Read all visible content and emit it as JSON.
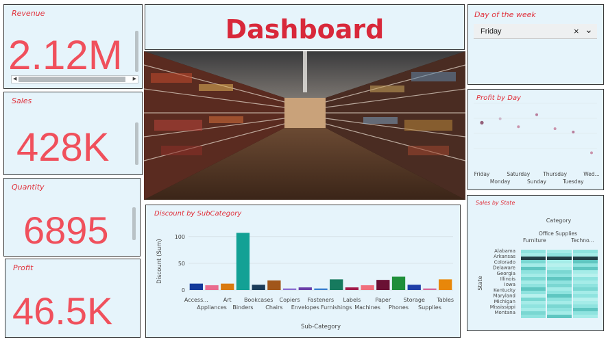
{
  "kpis": {
    "revenue": {
      "title": "Revenue",
      "value": "2.12M"
    },
    "sales": {
      "title": "Sales",
      "value": "428K"
    },
    "quantity": {
      "title": "Quantity",
      "value": "6895"
    },
    "profit": {
      "title": "Profit",
      "value": "46.5K"
    }
  },
  "header": {
    "title": "Dashboard"
  },
  "image": {
    "alt": "Supermarket aisle"
  },
  "filter": {
    "title": "Day of the week",
    "selected": "Friday",
    "clear_glyph": "×",
    "chevron_glyph": "⌄"
  },
  "colors": {
    "accent": "#e0303b",
    "kpi_value": "#f0505c",
    "panel_bg": "#e6f4fb"
  },
  "chart_data": [
    {
      "type": "bar",
      "title": "Discount  by SubCategory",
      "xlabel": "Sub-Category",
      "ylabel": "Discount (Sum)",
      "ylim": [
        0,
        110
      ],
      "yticks": [
        0,
        50,
        100
      ],
      "grid": true,
      "categories": [
        "Access...",
        "Appliances",
        "Art",
        "Binders",
        "Bookcases",
        "Chairs",
        "Copiers",
        "Envelopes",
        "Fasteners",
        "Furnishings",
        "Labels",
        "Machines",
        "Paper",
        "Phones",
        "Storage",
        "Supplies",
        "Tables"
      ],
      "values": [
        12,
        9,
        12,
        107,
        10,
        18,
        3,
        5,
        3,
        20,
        5,
        9,
        19,
        25,
        10,
        3,
        20
      ],
      "colors": [
        "#12399a",
        "#e96c8e",
        "#d97a10",
        "#13a195",
        "#1b3c5a",
        "#a1561a",
        "#8b6fd1",
        "#6a3da8",
        "#3a7fd0",
        "#167a5e",
        "#a11a49",
        "#f06f7c",
        "#6a1034",
        "#1f8f3a",
        "#1f3fa8",
        "#d76a9a",
        "#e8870a"
      ]
    },
    {
      "type": "scatter",
      "title": "Profit by Day",
      "categories": [
        "Friday",
        "Monday",
        "Saturday",
        "Sunday",
        "Thursday",
        "Tuesday",
        "Wed..."
      ],
      "values": [
        6100,
        6700,
        5500,
        7300,
        5200,
        4700,
        1600
      ],
      "ylim": [
        0,
        9000
      ],
      "grid": true
    },
    {
      "type": "heatmap",
      "title": "Sales by State",
      "column_group_label": "Category",
      "columns": [
        "Furniture",
        "Office Supplies",
        "Techno..."
      ],
      "row_axis_label": "State",
      "rows": [
        "Alabama",
        "Arkansas",
        "Colorado",
        "Delaware",
        "Georgia",
        "Illinois",
        "Iowa",
        "Kentucky",
        "Maryland",
        "Michigan",
        "Mississippi",
        "Montana"
      ]
    }
  ]
}
